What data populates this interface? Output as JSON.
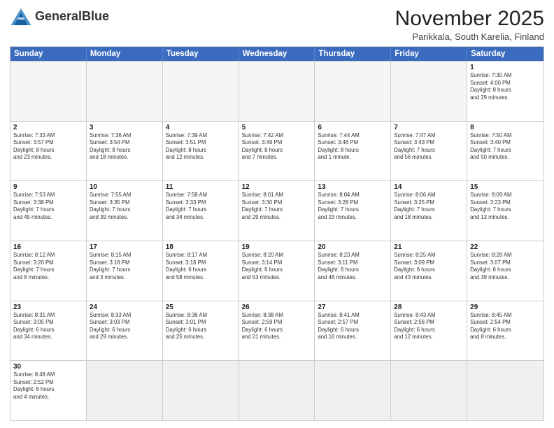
{
  "logo": {
    "text_regular": "General",
    "text_bold": "Blue"
  },
  "header": {
    "month": "November 2025",
    "location": "Parikkala, South Karelia, Finland"
  },
  "day_headers": [
    "Sunday",
    "Monday",
    "Tuesday",
    "Wednesday",
    "Thursday",
    "Friday",
    "Saturday"
  ],
  "weeks": [
    [
      {
        "day": "",
        "info": "",
        "empty": true
      },
      {
        "day": "",
        "info": "",
        "empty": true
      },
      {
        "day": "",
        "info": "",
        "empty": true
      },
      {
        "day": "",
        "info": "",
        "empty": true
      },
      {
        "day": "",
        "info": "",
        "empty": true
      },
      {
        "day": "",
        "info": "",
        "empty": true
      },
      {
        "day": "1",
        "info": "Sunrise: 7:30 AM\nSunset: 4:00 PM\nDaylight: 8 hours\nand 29 minutes.",
        "empty": false
      }
    ],
    [
      {
        "day": "2",
        "info": "Sunrise: 7:33 AM\nSunset: 3:57 PM\nDaylight: 8 hours\nand 23 minutes.",
        "empty": false
      },
      {
        "day": "3",
        "info": "Sunrise: 7:36 AM\nSunset: 3:54 PM\nDaylight: 8 hours\nand 18 minutes.",
        "empty": false
      },
      {
        "day": "4",
        "info": "Sunrise: 7:39 AM\nSunset: 3:51 PM\nDaylight: 8 hours\nand 12 minutes.",
        "empty": false
      },
      {
        "day": "5",
        "info": "Sunrise: 7:42 AM\nSunset: 3:49 PM\nDaylight: 8 hours\nand 7 minutes.",
        "empty": false
      },
      {
        "day": "6",
        "info": "Sunrise: 7:44 AM\nSunset: 3:46 PM\nDaylight: 8 hours\nand 1 minute.",
        "empty": false
      },
      {
        "day": "7",
        "info": "Sunrise: 7:47 AM\nSunset: 3:43 PM\nDaylight: 7 hours\nand 56 minutes.",
        "empty": false
      },
      {
        "day": "8",
        "info": "Sunrise: 7:50 AM\nSunset: 3:40 PM\nDaylight: 7 hours\nand 50 minutes.",
        "empty": false
      }
    ],
    [
      {
        "day": "9",
        "info": "Sunrise: 7:53 AM\nSunset: 3:38 PM\nDaylight: 7 hours\nand 45 minutes.",
        "empty": false
      },
      {
        "day": "10",
        "info": "Sunrise: 7:55 AM\nSunset: 3:35 PM\nDaylight: 7 hours\nand 39 minutes.",
        "empty": false
      },
      {
        "day": "11",
        "info": "Sunrise: 7:58 AM\nSunset: 3:33 PM\nDaylight: 7 hours\nand 34 minutes.",
        "empty": false
      },
      {
        "day": "12",
        "info": "Sunrise: 8:01 AM\nSunset: 3:30 PM\nDaylight: 7 hours\nand 29 minutes.",
        "empty": false
      },
      {
        "day": "13",
        "info": "Sunrise: 8:04 AM\nSunset: 3:28 PM\nDaylight: 7 hours\nand 23 minutes.",
        "empty": false
      },
      {
        "day": "14",
        "info": "Sunrise: 8:06 AM\nSunset: 3:25 PM\nDaylight: 7 hours\nand 18 minutes.",
        "empty": false
      },
      {
        "day": "15",
        "info": "Sunrise: 8:09 AM\nSunset: 3:23 PM\nDaylight: 7 hours\nand 13 minutes.",
        "empty": false
      }
    ],
    [
      {
        "day": "16",
        "info": "Sunrise: 8:12 AM\nSunset: 3:20 PM\nDaylight: 7 hours\nand 8 minutes.",
        "empty": false
      },
      {
        "day": "17",
        "info": "Sunrise: 8:15 AM\nSunset: 3:18 PM\nDaylight: 7 hours\nand 3 minutes.",
        "empty": false
      },
      {
        "day": "18",
        "info": "Sunrise: 8:17 AM\nSunset: 3:16 PM\nDaylight: 6 hours\nand 58 minutes.",
        "empty": false
      },
      {
        "day": "19",
        "info": "Sunrise: 8:20 AM\nSunset: 3:14 PM\nDaylight: 6 hours\nand 53 minutes.",
        "empty": false
      },
      {
        "day": "20",
        "info": "Sunrise: 8:23 AM\nSunset: 3:11 PM\nDaylight: 6 hours\nand 48 minutes.",
        "empty": false
      },
      {
        "day": "21",
        "info": "Sunrise: 8:25 AM\nSunset: 3:09 PM\nDaylight: 6 hours\nand 43 minutes.",
        "empty": false
      },
      {
        "day": "22",
        "info": "Sunrise: 8:28 AM\nSunset: 3:07 PM\nDaylight: 6 hours\nand 39 minutes.",
        "empty": false
      }
    ],
    [
      {
        "day": "23",
        "info": "Sunrise: 8:31 AM\nSunset: 3:05 PM\nDaylight: 6 hours\nand 34 minutes.",
        "empty": false
      },
      {
        "day": "24",
        "info": "Sunrise: 8:33 AM\nSunset: 3:03 PM\nDaylight: 6 hours\nand 29 minutes.",
        "empty": false
      },
      {
        "day": "25",
        "info": "Sunrise: 8:36 AM\nSunset: 3:01 PM\nDaylight: 6 hours\nand 25 minutes.",
        "empty": false
      },
      {
        "day": "26",
        "info": "Sunrise: 8:38 AM\nSunset: 2:59 PM\nDaylight: 6 hours\nand 21 minutes.",
        "empty": false
      },
      {
        "day": "27",
        "info": "Sunrise: 8:41 AM\nSunset: 2:57 PM\nDaylight: 6 hours\nand 16 minutes.",
        "empty": false
      },
      {
        "day": "28",
        "info": "Sunrise: 8:43 AM\nSunset: 2:56 PM\nDaylight: 6 hours\nand 12 minutes.",
        "empty": false
      },
      {
        "day": "29",
        "info": "Sunrise: 8:45 AM\nSunset: 2:54 PM\nDaylight: 6 hours\nand 8 minutes.",
        "empty": false
      }
    ],
    [
      {
        "day": "30",
        "info": "Sunrise: 8:48 AM\nSunset: 2:52 PM\nDaylight: 6 hours\nand 4 minutes.",
        "empty": false
      },
      {
        "day": "",
        "info": "",
        "empty": true
      },
      {
        "day": "",
        "info": "",
        "empty": true
      },
      {
        "day": "",
        "info": "",
        "empty": true
      },
      {
        "day": "",
        "info": "",
        "empty": true
      },
      {
        "day": "",
        "info": "",
        "empty": true
      },
      {
        "day": "",
        "info": "",
        "empty": true
      }
    ]
  ]
}
